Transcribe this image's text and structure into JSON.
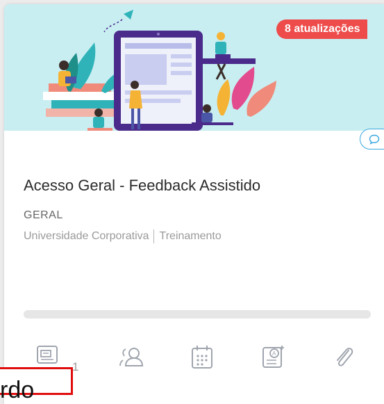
{
  "card": {
    "badge": "8 atualizações",
    "title": "Acesso Geral - Feedback Assistido",
    "category": "GERAL",
    "meta": [
      "Universidade Corporativa",
      "Treinamento"
    ],
    "progress_fraction": 0.0,
    "actions": [
      {
        "icon": "document-icon",
        "count": "1"
      },
      {
        "icon": "people-icon"
      },
      {
        "icon": "calendar-icon"
      },
      {
        "icon": "assessment-icon"
      },
      {
        "icon": "paperclip-icon"
      }
    ]
  },
  "overlay": {
    "text": "rdo"
  },
  "colors": {
    "banner_bg": "#c8eef2",
    "badge": "#ee4b4b",
    "accent": "#3aa7e0",
    "outline_red": "#e00d0d"
  }
}
